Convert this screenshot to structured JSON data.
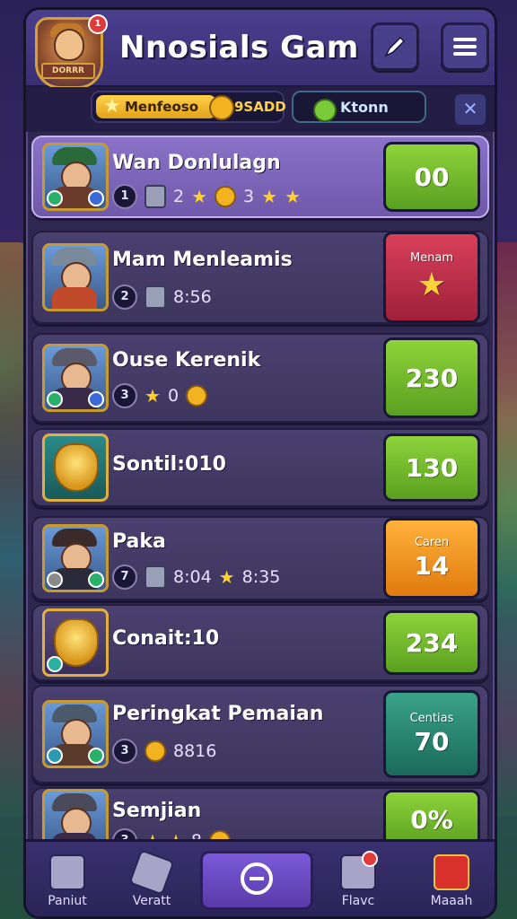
{
  "header": {
    "title": "Nnosials Gam",
    "logo_text": "DORRR",
    "logo_badge": "1"
  },
  "tabs": {
    "gold_label": "Menfeoso",
    "gold_amount": "9SADD",
    "green_label": "Ktonn",
    "close_glyph": "✕"
  },
  "rows": [
    {
      "name": "Wan Donlulagn",
      "rank": "1",
      "stats": "2",
      "extra": "3",
      "score": "00",
      "caption": ""
    },
    {
      "name": "Mam Menleamis",
      "rank": "2",
      "stats": "8:56",
      "extra": "",
      "score": "",
      "caption": "Menam"
    },
    {
      "name": "Ouse Kerenik",
      "rank": "3",
      "stats": "0",
      "extra": "",
      "score": "230",
      "caption": ""
    },
    {
      "name": "Sontil:010",
      "rank": "",
      "stats": "",
      "extra": "",
      "score": "130",
      "caption": ""
    },
    {
      "name": "Paka",
      "rank": "7",
      "stats": "8:04",
      "extra": "8:35",
      "score": "14",
      "caption": "Caren"
    },
    {
      "name": "Conait:10",
      "rank": "",
      "stats": "",
      "extra": "",
      "score": "234",
      "caption": ""
    },
    {
      "name": "Peringkat Pemaian",
      "rank": "3",
      "stats": "8816",
      "extra": "",
      "score": "70",
      "caption": "Centias"
    },
    {
      "name": "Semjian",
      "rank": "3",
      "stats": "8",
      "extra": "",
      "score": "0%",
      "caption": ""
    }
  ],
  "nav": {
    "item1": "Paniut",
    "item2": "Veratt",
    "item4": "Flavc",
    "item4_badge": "1",
    "item5": "Maaah"
  },
  "colors": {
    "highlight": "#7a62b8",
    "green": "#7ac02a",
    "red": "#c0304a",
    "orange": "#f29a20",
    "teal": "#2a8a7a"
  }
}
